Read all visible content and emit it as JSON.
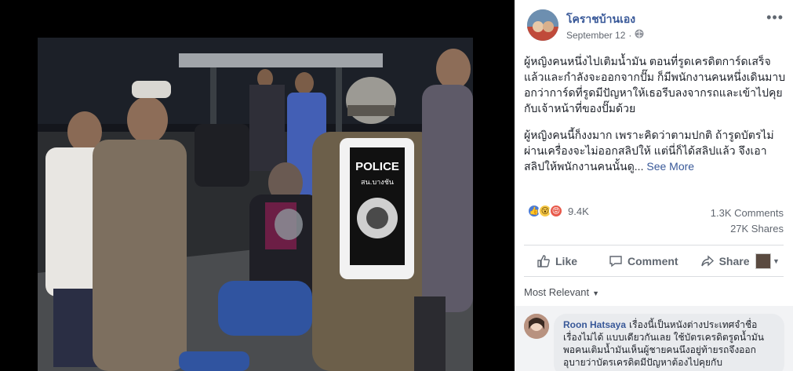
{
  "post": {
    "page_name": "โคราชบ้านเอง",
    "date": "September 12",
    "paragraph_1": "ผู้หญิงคนหนึ่งไปเติมน้ำมัน ตอนที่รูดเครดิตการ์ดเสร็จแล้วและกำลังจะออกจากปั๊ม ก็มีพนักงานคนหนึ่งเดินมาบอกว่าการ์ดที่รูดมีปัญหาให้เธอรีบลงจากรถและเข้าไปคุยกับเจ้าหน้าที่ของปั๊มด้วย",
    "paragraph_2": "ผู้หญิงคนนี้ก็งงมาก เพราะคิดว่าตามปกติ ถ้ารูดบัตรไม่ผ่านเครื่องจะไม่ออกสลิปให้ แต่นี่ก็ได้สลิปแล้ว จึงเอาสลิปให้พนักงานคนนั้นดู...",
    "see_more": "See More",
    "photo_vest_text": "POLICE",
    "photo_vest_subtext": "สน.บางชัน"
  },
  "stats": {
    "reaction_count": "9.4K",
    "comments": "1.3K Comments",
    "shares": "27K Shares"
  },
  "actions": {
    "like": "Like",
    "comment": "Comment",
    "share": "Share"
  },
  "comments": {
    "sort_label": "Most Relevant",
    "first": {
      "author": "Roon Hatsaya",
      "text": "เรื่องนี้เป็นหนังต่างประเทศจำชื่อเรื่องไม่ได้ แบบเดียวกันเลย ใช้บัตรเครดิตรูดน้ำมัน พอคนเติมน้ำมันเห็นผู้ชายคนนึงอยู่ท้ายรถจึงออกอุบายว่าบัตรเครดิตมีปัญหาต้องไปคุยกับ"
    }
  },
  "icons": [
    "more-icon",
    "globe-icon",
    "like-reaction-icon",
    "wow-reaction-icon",
    "angry-reaction-icon",
    "thumbs-up-icon",
    "comment-icon",
    "share-icon",
    "caret-down-icon"
  ],
  "colors": {
    "link": "#385898",
    "muted": "#616770",
    "text": "#1d2129",
    "divider": "#dadde1"
  }
}
